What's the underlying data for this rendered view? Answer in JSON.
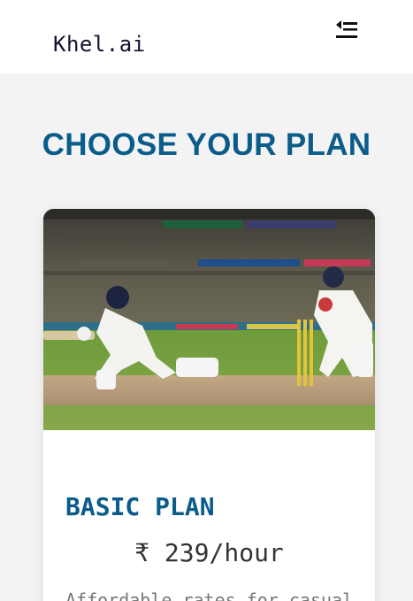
{
  "header": {
    "brand": "Khel.ai",
    "menu_icon": "menu-collapse-icon"
  },
  "page": {
    "title": "CHOOSE YOUR PLAN"
  },
  "plans": [
    {
      "image": "cricket-batsman-photo",
      "name": "BASIC PLAN",
      "price": "₹ 239/hour",
      "description": "Affordable rates for casual"
    }
  ],
  "colors": {
    "accent": "#0a5c8a",
    "brand_text": "#14122e",
    "background": "#f3f3f3"
  }
}
